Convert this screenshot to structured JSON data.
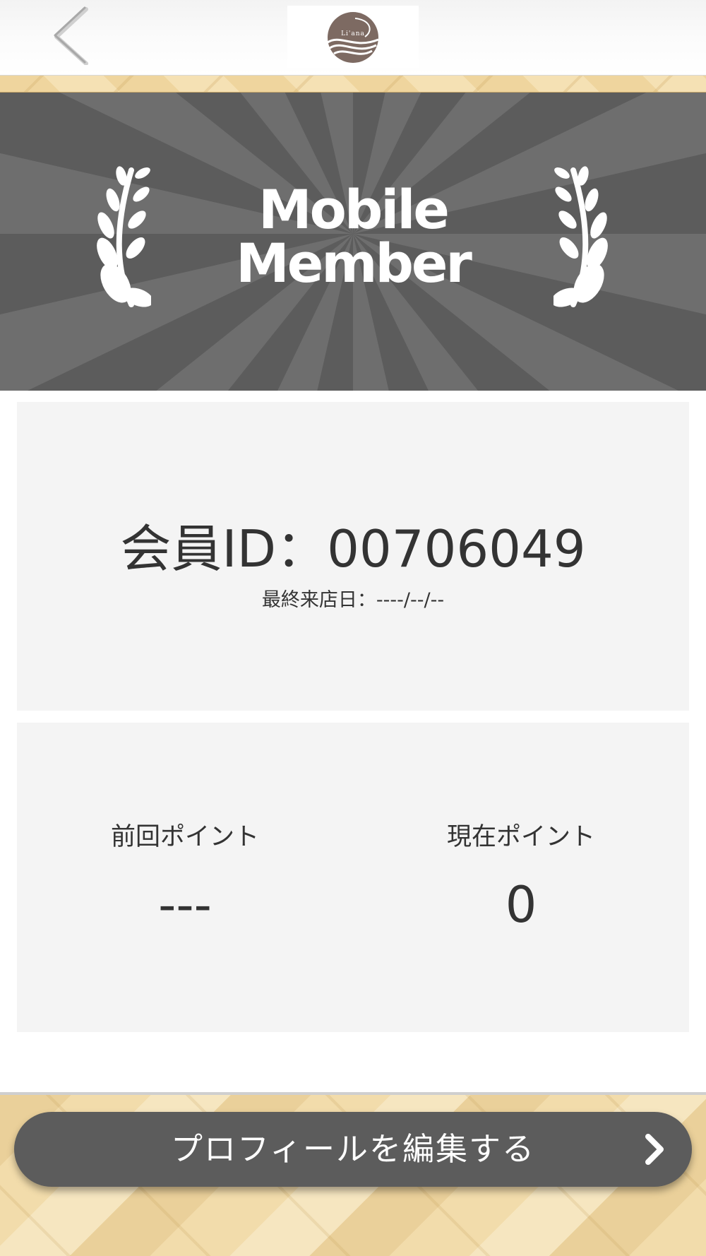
{
  "header": {
    "back_icon": "chevron-left-icon",
    "logo_text": "Li'ana"
  },
  "banner": {
    "title_line1": "Mobile",
    "title_line2": "Member",
    "laurel_icon": "laurel-branch-icon"
  },
  "member": {
    "id_text": "会員ID：00706049",
    "last_visit_text": "最終来店日：----/--/--"
  },
  "points": {
    "previous_label": "前回ポイント",
    "previous_value": "---",
    "current_label": "現在ポイント",
    "current_value": "0"
  },
  "footer": {
    "edit_profile_label": "プロフィールを編集する",
    "arrow_icon": "chevron-right-icon"
  },
  "colors": {
    "banner_bg": "#5c5c5c",
    "card_bg": "#f4f4f4",
    "button_bg": "#5c5c5c",
    "logo_brown": "#7d6a62"
  }
}
